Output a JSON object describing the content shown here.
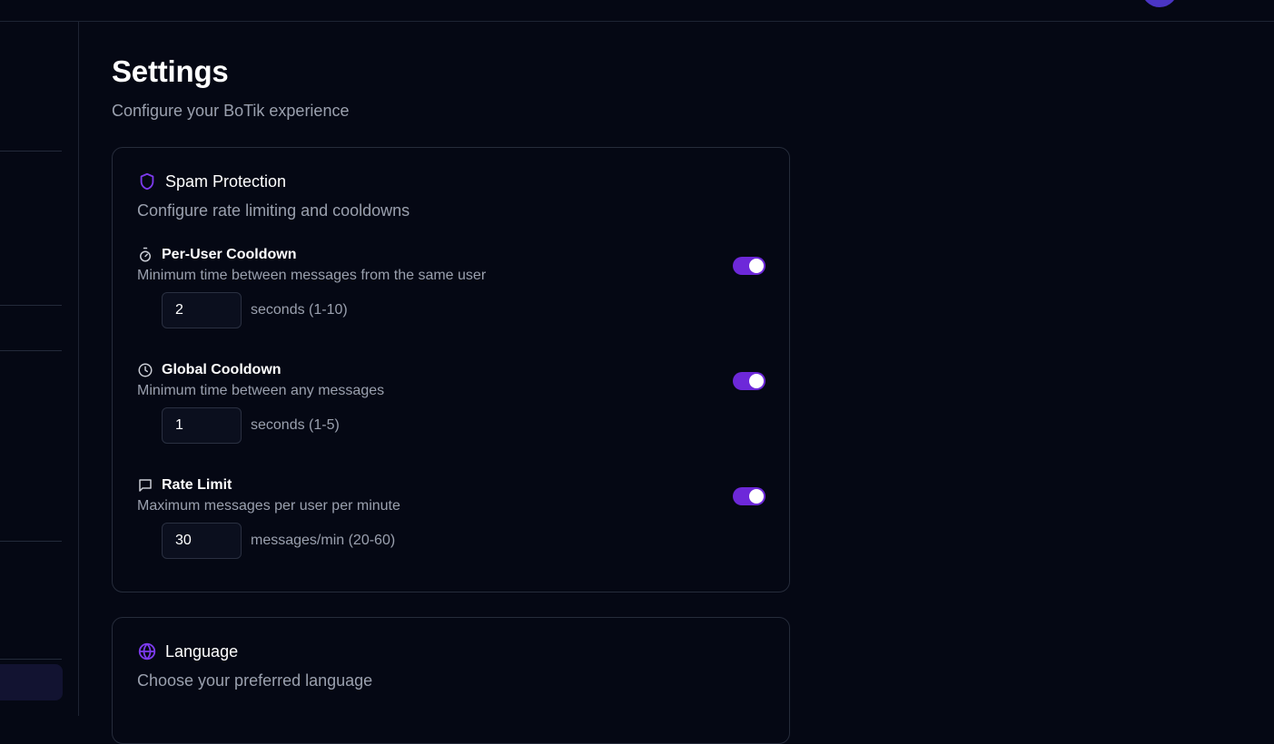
{
  "header": {
    "title": "Settings",
    "subtitle": "Configure your BoTik experience"
  },
  "colors": {
    "accent": "#6d28d9",
    "background": "#050814",
    "muted_text": "#9aa0ae"
  },
  "spam": {
    "title": "Spam Protection",
    "description": "Configure rate limiting and cooldowns",
    "icon": "shield-icon",
    "settings": [
      {
        "label": "Per-User Cooldown",
        "description": "Minimum time between messages from the same user",
        "icon": "stopwatch-icon",
        "enabled": true,
        "value": "2",
        "unit": "seconds (1-10)"
      },
      {
        "label": "Global Cooldown",
        "description": "Minimum time between any messages",
        "icon": "clock-icon",
        "enabled": true,
        "value": "1",
        "unit": "seconds (1-5)"
      },
      {
        "label": "Rate Limit",
        "description": "Maximum messages per user per minute",
        "icon": "message-icon",
        "enabled": true,
        "value": "30",
        "unit": "messages/min (20-60)"
      }
    ]
  },
  "language": {
    "title": "Language",
    "description": "Choose your preferred language",
    "icon": "globe-icon"
  }
}
